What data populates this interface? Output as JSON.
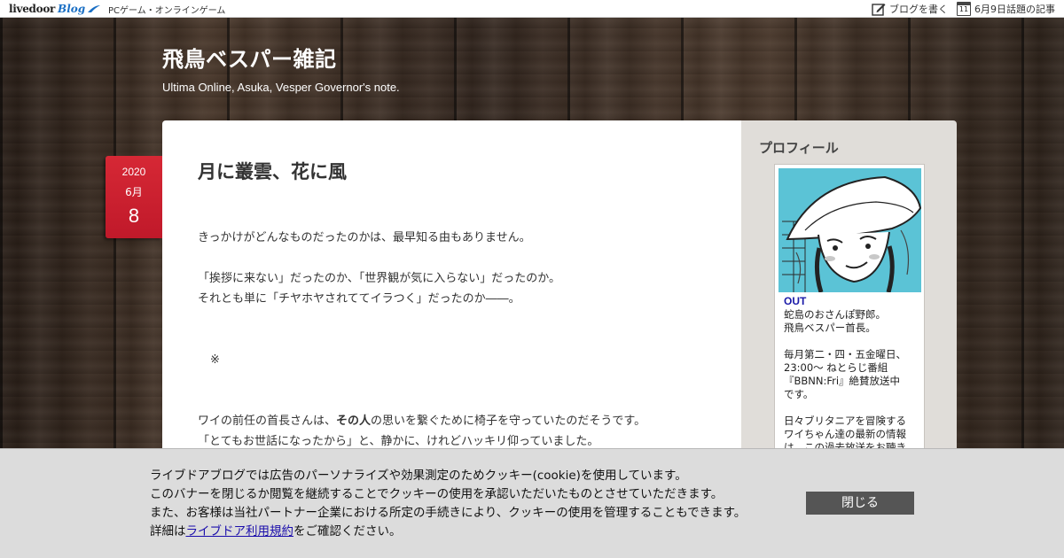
{
  "topbar": {
    "logo_main": "livedoor",
    "logo_blog": "Blog",
    "category": "PCゲーム・オンラインゲーム",
    "write_blog": "ブログを書く",
    "calendar_day": "11",
    "topic_link": "6月9日話題の記事"
  },
  "header": {
    "title": "飛鳥ベスパー雑記",
    "description": "Ultima Online, Asuka, Vesper Governor's note."
  },
  "post": {
    "date": {
      "year": "2020",
      "month": "6月",
      "day": "8"
    },
    "title": "月に叢雲、花に風",
    "body": {
      "p1": "きっかけがどんなものだったのかは、最早知る由もありません。",
      "p2": "「挨拶に来ない」だったのか、「世界観が気に入らない」だったのか。",
      "p3": "それとも単に「チヤホヤされててイラつく」だったのか――。",
      "mark": "※",
      "p4_a": "ワイの前任の首長さんは、",
      "p4_b": "その人",
      "p4_c": "の思いを繋ぐために椅子を守っていたのだそうです。",
      "p5": "「とてもお世話になったから」と、静かに、けれどハッキリ仰っていました。"
    }
  },
  "sidebar": {
    "heading": "プロフィール",
    "profile": {
      "name": "OUT",
      "line1": "蛇島のおさんぽ野郎。",
      "line2": "飛鳥ベスパー首長。",
      "line3": "毎月第二・四・五金曜日、",
      "line4": "23:00～ ねとらじ番組",
      "line5": "『BBNN:Fri』絶賛放送中",
      "line6": "です。",
      "line7": "日々ブリタニアを冒険する",
      "line8": "ワイちゃん達の最新の情報",
      "line9": "は、この過去放送をお聴き"
    }
  },
  "cookie": {
    "line1": "ライブドアブログでは広告のパーソナライズや効果測定のためクッキー(cookie)を使用しています。",
    "line2": "このバナーを閉じるか閲覧を継続することでクッキーの使用を承認いただいたものとさせていただきます。",
    "line3": "また、お客様は当社パートナー企業における所定の手続きにより、クッキーの使用を管理することもできます。",
    "line4_prefix": "詳細は",
    "line4_link": "ライブドア利用規約",
    "line4_suffix": "をご確認ください。",
    "close_label": "閉じる"
  },
  "colors": {
    "date_badge": "#c0192a",
    "close_button": "#555555",
    "profile_name": "#1a1aa8",
    "link": "#1a0dab"
  }
}
